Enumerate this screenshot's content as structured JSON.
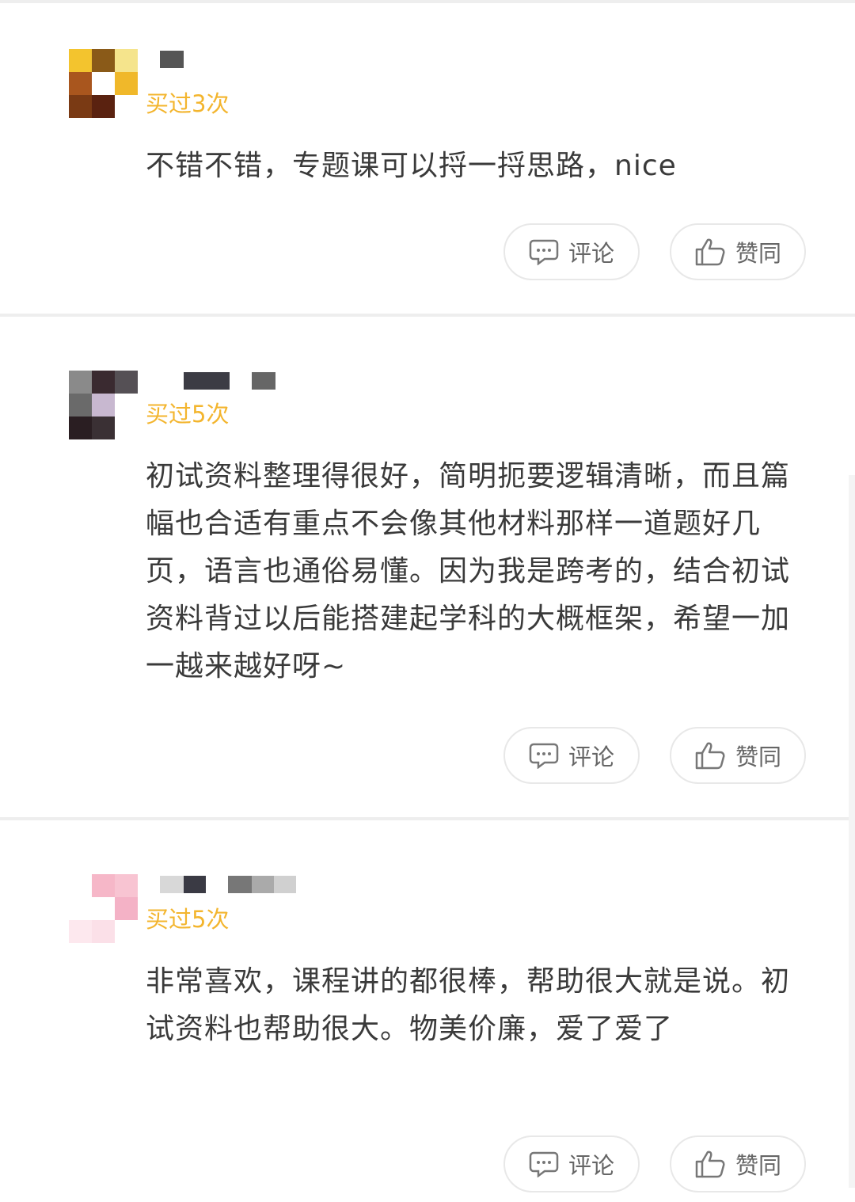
{
  "reviews": [
    {
      "badge": "买过3次",
      "text": "不错不错，专题课可以捋一捋思路，nice",
      "actions": {
        "comment": "评论",
        "like": "赞同"
      },
      "avatar_colors": [
        "#f3c42e",
        "#8a5a18",
        "#f5e48c",
        "#a9561e",
        "#ffffff",
        "#f0b82a",
        "#7a3a14",
        "#5a2210",
        "#ffffff"
      ]
    },
    {
      "badge": "买过5次",
      "text": "初试资料整理得很好，简明扼要逻辑清晰，而且篇幅也合适有重点不会像其他材料那样一道题好几页，语言也通俗易懂。因为我是跨考的，结合初试资料背过以后能搭建起学科的大概框架，希望一加一越来越好呀~",
      "actions": {
        "comment": "评论",
        "like": "赞同"
      },
      "avatar_colors": [
        "#8a8a8a",
        "#3a2a30",
        "#555055",
        "#6a6a6a",
        "#c8b8d0",
        "#ffffff",
        "#2a1e22",
        "#3a3034",
        "#ffffff"
      ]
    },
    {
      "badge": "买过5次",
      "text": "非常喜欢，课程讲的都很棒，帮助很大就是说。初试资料也帮助很大。物美价廉，爱了爱了",
      "actions": {
        "comment": "评论",
        "like": "赞同"
      },
      "avatar_colors": [
        "#ffffff",
        "#f6b7c8",
        "#f8c4d2",
        "#ffffff",
        "#ffffff",
        "#f4b2c6",
        "#fde8ee",
        "#fbe0e8",
        "#ffffff"
      ]
    }
  ],
  "colors": {
    "badge": "#f3b52e",
    "text": "#3a3a3a",
    "divider": "#eeeeee"
  },
  "icons": {
    "comment": "comment-bubble-icon",
    "like": "thumbs-up-icon"
  }
}
